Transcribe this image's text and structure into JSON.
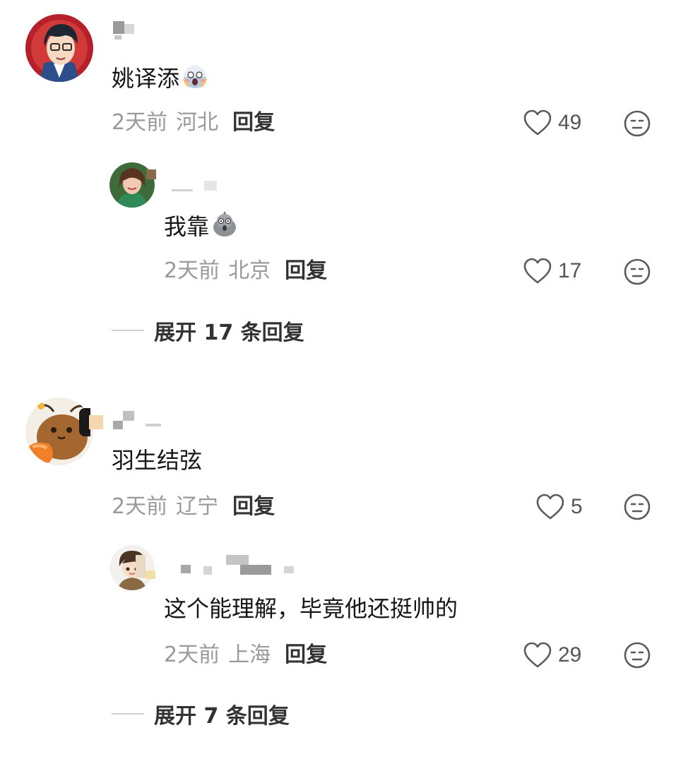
{
  "comments": [
    {
      "text": "姚译添",
      "emoji_icon": "face-screaming-in-fear-icon",
      "time": "2天前",
      "location": "河北",
      "reply_label": "回复",
      "likes": "49",
      "replies": [
        {
          "text": "我靠",
          "emoji_icon": "shocked-pigeon-sticker-icon",
          "time": "2天前",
          "location": "北京",
          "reply_label": "回复",
          "likes": "17"
        }
      ],
      "expand_label": "展开 17 条回复"
    },
    {
      "text": "羽生结弦",
      "time": "2天前",
      "location": "辽宁",
      "reply_label": "回复",
      "likes": "5",
      "replies": [
        {
          "text": "这个能理解，毕竟他还挺帅的",
          "time": "2天前",
          "location": "上海",
          "reply_label": "回复",
          "likes": "29"
        }
      ],
      "expand_label": "展开 7 条回复"
    }
  ],
  "colors": {
    "meta_text": "#9a9a9a",
    "reply_text": "#333333",
    "icon_stroke": "#5a5a5a",
    "divider": "#cfcfcf"
  }
}
